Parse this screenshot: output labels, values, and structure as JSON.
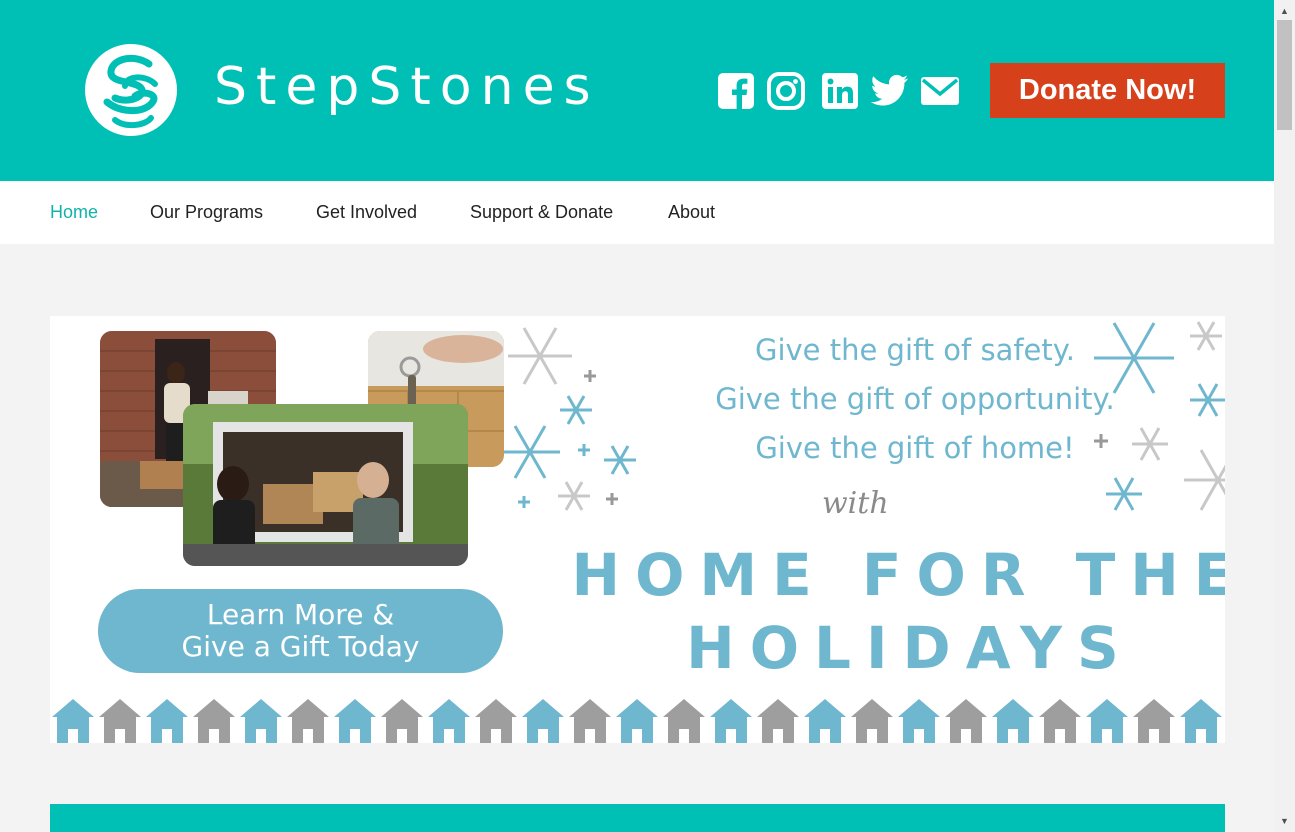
{
  "header": {
    "logo_text": "StepStones",
    "donate_label": "Donate Now!",
    "social": [
      "facebook-icon",
      "instagram-icon",
      "linkedin-icon",
      "twitter-icon",
      "email-icon"
    ],
    "bg_color": "#00bfb5",
    "donate_color": "#d6401b"
  },
  "nav": {
    "items": [
      {
        "label": "Home",
        "active": true
      },
      {
        "label": "Our Programs",
        "active": false
      },
      {
        "label": "Get Involved",
        "active": false
      },
      {
        "label": "Support & Donate",
        "active": false
      },
      {
        "label": "About",
        "active": false
      }
    ],
    "active_color": "#13b1ab"
  },
  "banner": {
    "lines": [
      "Give the gift of safety.",
      "Give the gift of opportunity.",
      "Give the gift of home!"
    ],
    "with": "with",
    "campaign_line1": "HOME FOR THE",
    "campaign_line2": "HOLIDAYS",
    "button_line1": "Learn More &",
    "button_line2": "Give a Gift Today",
    "accent_color": "#6fb7cf",
    "house_colors": [
      "#6fb7cf",
      "#9e9e9e"
    ]
  }
}
